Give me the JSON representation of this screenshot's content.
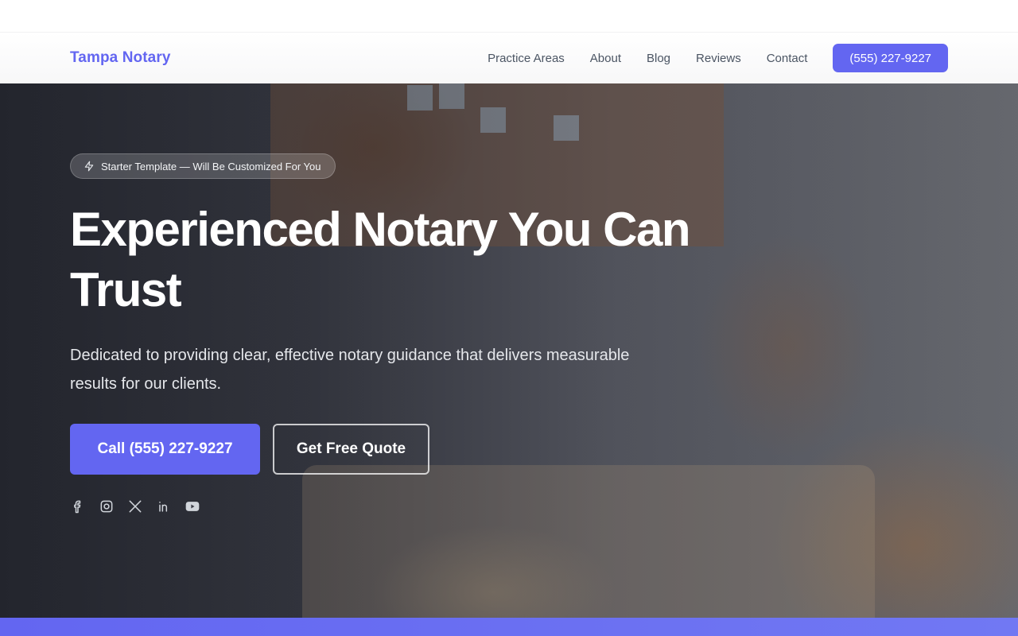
{
  "header": {
    "brand": "Tampa Notary",
    "nav": [
      "Practice Areas",
      "About",
      "Blog",
      "Reviews",
      "Contact"
    ],
    "phone_button": "(555) 227-9227"
  },
  "hero": {
    "badge": "Starter Template — Will Be Customized For You",
    "headline": "Experienced Notary You Can Trust",
    "subheadline": "Dedicated to providing clear, effective notary guidance that delivers measurable results for our clients.",
    "primary_cta": "Call (555) 227-9227",
    "secondary_cta": "Get Free Quote",
    "socials": [
      "facebook-icon",
      "instagram-icon",
      "x-icon",
      "linkedin-icon",
      "youtube-icon"
    ]
  },
  "colors": {
    "accent": "#6366f1",
    "nav_text": "#4b5563"
  }
}
